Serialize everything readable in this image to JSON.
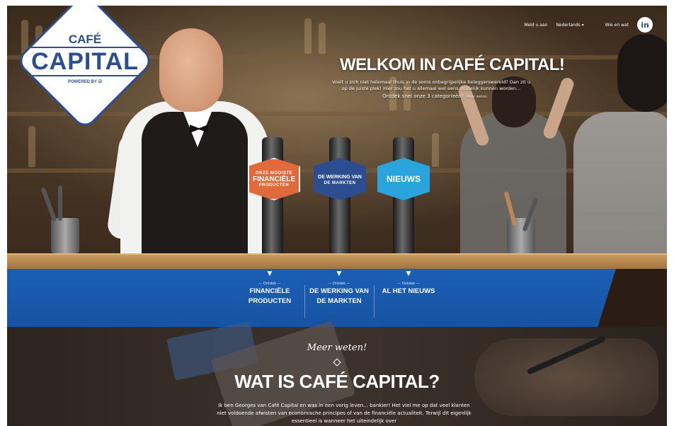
{
  "logo": {
    "cafe": "CAFÉ",
    "capital": "CAPITAL",
    "powered": "POWERED BY ☑"
  },
  "topnav": {
    "item1": "Meld u aan",
    "language": "Nederlands ▾",
    "item3": "Wie en wat",
    "linkedin": "in"
  },
  "hero": {
    "title": "WELKOM IN CAFÉ CAPITAL!",
    "text": "Voelt u zich niet helemaal thuis in de soms onbegrijpelijke beleggerswereld? Dan zit u op de juiste plek! Hier zou het u allemaal wel eens duidelijk kunnen worden...",
    "cta": "Ontdek snel onze 3 categorieën!",
    "more": "Meer weten"
  },
  "taps": [
    {
      "small": "ONZE MOOISTE",
      "big": "FINANCIËLE",
      "small2": "PRODUCTEN"
    },
    {
      "small": "",
      "big": "DE WERKING VAN",
      "small2": "DE MARKTEN"
    },
    {
      "small": "",
      "big": "NIEUWS",
      "small2": ""
    }
  ],
  "categories": [
    {
      "small": "— Ontdek —",
      "label1": "FINANCIËLE",
      "label2": "PRODUCTEN"
    },
    {
      "small": "— Ontdek —",
      "label1": "DE WERKING VAN",
      "label2": "DE MARKTEN"
    },
    {
      "small": "— Ontdek —",
      "label1": "AL HET NIEUWS",
      "label2": ""
    }
  ],
  "about": {
    "meer": "Meer weten!",
    "title": "WAT IS CAFÉ CAPITAL?",
    "text": "Ik ben Georges van Café Capital en was in een vorig leven... bankier! Het viel me op dat veel klanten niet voldoende afwisten van economische principes of van de financiële actualiteit. Terwijl dit eigenlijk essentieel is wanneer het uiteindelijk over"
  },
  "colors": {
    "brand_blue": "#2c4d8f",
    "band_blue": "#1b5fb5",
    "orange": "#e06a3c",
    "cyan": "#2aa4dc"
  }
}
